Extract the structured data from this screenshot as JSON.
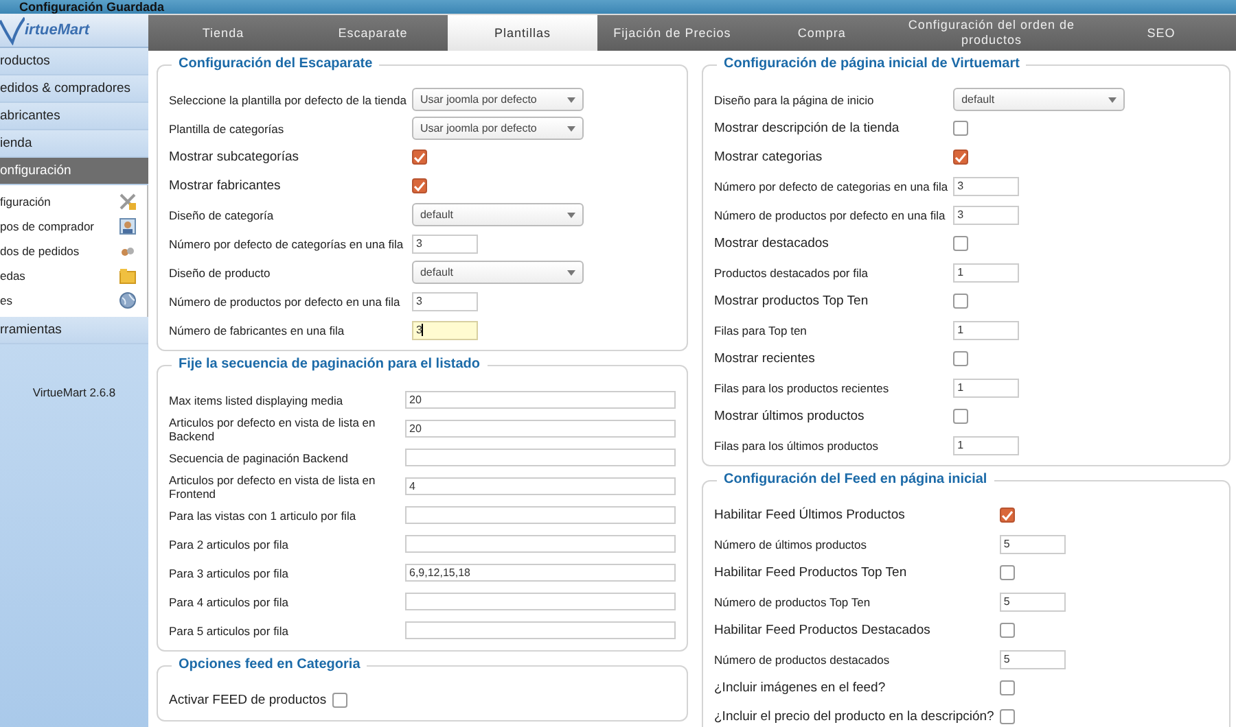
{
  "notice": "Configuración Guardada",
  "sidebar": {
    "logo": "irtueMart",
    "items": [
      {
        "label": "roductos",
        "selected": false
      },
      {
        "label": "edidos & compradores",
        "selected": false
      },
      {
        "label": "abricantes",
        "selected": false
      },
      {
        "label": "ienda",
        "selected": false
      },
      {
        "label": "onfiguración",
        "selected": true
      }
    ],
    "submenu": [
      {
        "label": "figuración"
      },
      {
        "label": "pos de comprador"
      },
      {
        "label": "dos de pedidos"
      },
      {
        "label": "edas"
      },
      {
        "label": "es"
      }
    ],
    "items_after": [
      {
        "label": "rramientas",
        "selected": false
      }
    ],
    "version": "VirtueMart 2.6.8"
  },
  "tabs": [
    {
      "label": "Tienda",
      "selected": false
    },
    {
      "label": "Escaparate",
      "selected": false
    },
    {
      "label": "Plantillas",
      "selected": true
    },
    {
      "label": "Fijación de Precios",
      "selected": false
    },
    {
      "label": "Compra",
      "selected": false
    },
    {
      "label": "Configuración del orden de productos",
      "selected": false
    },
    {
      "label": "SEO",
      "selected": false
    }
  ],
  "columns": [
    {
      "sections": [
        {
          "title": "Configuración del Escaparate",
          "rows": [
            {
              "kind": "select",
              "label": "Seleccione la plantilla por defecto de la tienda",
              "value": "Usar joomla por defecto"
            },
            {
              "kind": "select",
              "label": "Plantilla de categorías",
              "value": "Usar joomla por defecto"
            },
            {
              "kind": "checkbox",
              "label": "Mostrar subcategorías",
              "checked": true
            },
            {
              "kind": "checkbox",
              "label": "Mostrar fabricantes",
              "checked": true
            },
            {
              "kind": "select",
              "label": "Diseño de categoría",
              "value": "default"
            },
            {
              "kind": "text",
              "label": "Número por defecto de categorías en una fila",
              "value": "3",
              "focused": false
            },
            {
              "kind": "select",
              "label": "Diseño de producto",
              "value": "default"
            },
            {
              "kind": "text",
              "label": "Número de productos por defecto en una fila",
              "value": "3",
              "focused": false
            },
            {
              "kind": "text",
              "label": "Número de fabricantes en una fila",
              "value": "3",
              "focused": true
            }
          ]
        },
        {
          "title": "Fije la secuencia de paginación para el listado",
          "rows": [
            {
              "kind": "wide",
              "label": "Max items listed displaying media",
              "value": "20"
            },
            {
              "kind": "wide",
              "label": "Articulos por defecto en vista de lista en Backend",
              "value": "20"
            },
            {
              "kind": "wide",
              "label": "Secuencia de paginación Backend"
            },
            {
              "kind": "wide",
              "label": "Articulos por defecto en vista de lista en Frontend",
              "value": "4"
            },
            {
              "kind": "wide",
              "label": "Para las vistas con 1 articulo por fila"
            },
            {
              "kind": "wide",
              "label": "Para 2 articulos por fila"
            },
            {
              "kind": "wide",
              "label": "Para 3 articulos por fila",
              "value": "6,9,12,15,18"
            },
            {
              "kind": "wide",
              "label": "Para 4 articulos por fila"
            },
            {
              "kind": "wide",
              "label": "Para 5 articulos por fila"
            }
          ]
        },
        {
          "title": "Opciones feed en Categoria",
          "rows": [
            {
              "kind": "checkbox",
              "label": "Activar FEED de productos",
              "checked": false
            }
          ]
        }
      ]
    },
    {
      "sections": [
        {
          "title": "Configuración de página inicial de Virtuemart",
          "rows": [
            {
              "kind": "select",
              "label": "Diseño para la página de inicio",
              "value": "default"
            },
            {
              "kind": "checkbox",
              "label": "Mostrar descripción de la tienda",
              "checked": false
            },
            {
              "kind": "checkbox",
              "label": "Mostrar categorias",
              "checked": true
            },
            {
              "kind": "text",
              "label": "Número por defecto de categorias en una fila",
              "value": "3",
              "focused": false
            },
            {
              "kind": "text",
              "label": "Número de productos por defecto en una fila",
              "value": "3",
              "focused": false
            },
            {
              "kind": "checkbox",
              "label": "Mostrar destacados",
              "checked": false
            },
            {
              "kind": "text",
              "label": "Productos destacados por fila",
              "value": "1",
              "focused": false
            },
            {
              "kind": "checkbox",
              "label": "Mostrar productos Top Ten",
              "checked": false
            },
            {
              "kind": "text",
              "label": "Filas para Top ten",
              "value": "1",
              "focused": false
            },
            {
              "kind": "checkbox",
              "label": "Mostrar recientes",
              "checked": false
            },
            {
              "kind": "text",
              "label": "Filas para los productos recientes",
              "value": "1",
              "focused": false
            },
            {
              "kind": "checkbox",
              "label": "Mostrar últimos productos",
              "checked": false
            },
            {
              "kind": "text",
              "label": "Filas para los últimos productos",
              "value": "1",
              "focused": false
            }
          ]
        },
        {
          "title": "Configuración del Feed en página inicial",
          "rows": [
            {
              "kind": "checkbox",
              "label": "Habilitar Feed Últimos Productos",
              "checked": true
            },
            {
              "kind": "text",
              "label": "Número de últimos productos",
              "value": "5",
              "focused": false
            },
            {
              "kind": "checkbox",
              "label": "Habilitar Feed Productos Top Ten",
              "checked": false
            },
            {
              "kind": "text",
              "label": "Número de productos Top Ten",
              "value": "5",
              "focused": false
            },
            {
              "kind": "checkbox",
              "label": "Habilitar Feed Productos Destacados",
              "checked": false
            },
            {
              "kind": "text",
              "label": "Número de productos destacados",
              "value": "5",
              "focused": false
            },
            {
              "kind": "checkbox",
              "label": "¿Incluir imágenes en el feed?",
              "checked": false
            },
            {
              "kind": "checkbox",
              "label": "¿Incluir el precio del producto en la descripción?",
              "checked": false
            }
          ]
        }
      ]
    }
  ]
}
